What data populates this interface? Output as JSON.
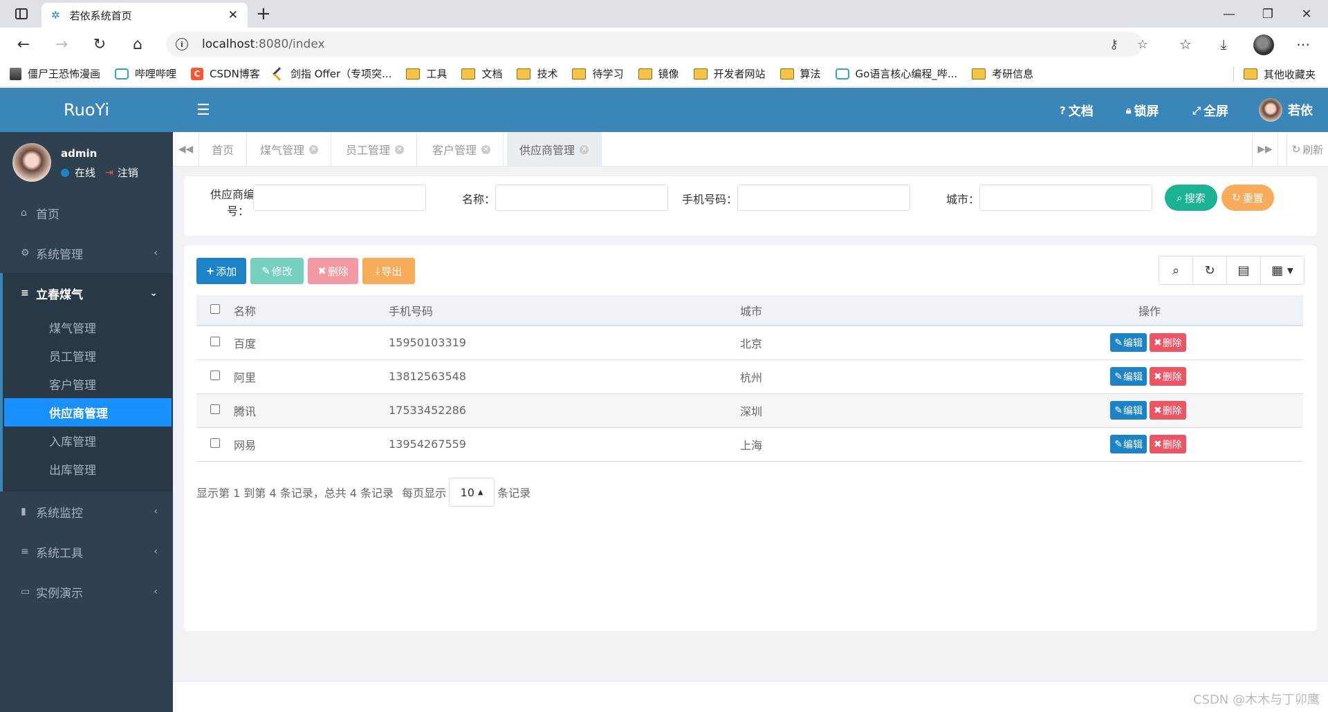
{
  "browser": {
    "tab_title": "若依系统首页",
    "url_host": "localhost",
    "url_rest": ":8080/index",
    "bookmarks": [
      {
        "label": "僵尸王恐怖漫画",
        "icon": "image-icon"
      },
      {
        "label": "哔哩哔哩",
        "icon": "bilibili-icon"
      },
      {
        "label": "CSDN博客",
        "icon": "csdn-icon"
      },
      {
        "label": "剑指 Offer（专项突...",
        "icon": "leetcode-icon"
      },
      {
        "label": "工具",
        "icon": "folder-icon"
      },
      {
        "label": "文档",
        "icon": "folder-icon"
      },
      {
        "label": "技术",
        "icon": "folder-icon"
      },
      {
        "label": "待学习",
        "icon": "folder-icon"
      },
      {
        "label": "镜像",
        "icon": "folder-icon"
      },
      {
        "label": "开发者网站",
        "icon": "folder-icon"
      },
      {
        "label": "算法",
        "icon": "folder-icon"
      },
      {
        "label": "Go语言核心编程_哔...",
        "icon": "bilibili-icon"
      },
      {
        "label": "考研信息",
        "icon": "folder-icon"
      }
    ],
    "other_bookmarks": "其他收藏夹"
  },
  "app": {
    "logo": "RuoYi",
    "user": {
      "name": "admin",
      "status": "在线",
      "logout": "注销"
    },
    "menu": {
      "home": "首页",
      "system": "系统管理",
      "lichun": "立春煤气",
      "sub": [
        "煤气管理",
        "员工管理",
        "客户管理",
        "供应商管理",
        "入库管理",
        "出库管理"
      ],
      "monitor": "系统监控",
      "tools": "系统工具",
      "demo": "实例演示"
    },
    "topbar": {
      "docs": "文档",
      "lock": "锁屏",
      "fullscreen": "全屏",
      "user": "若依"
    },
    "tabs": [
      "首页",
      "煤气管理",
      "员工管理",
      "客户管理",
      "供应商管理"
    ],
    "refresh": "刷新"
  },
  "search": {
    "label_code_1": "供应商编",
    "label_code_2": "号：",
    "label_name": "名称：",
    "label_phone": "手机号码：",
    "label_city": "城市：",
    "btn_search": "搜索",
    "btn_reset": "重置"
  },
  "toolbar": {
    "add": "添加",
    "edit": "修改",
    "delete": "删除",
    "export": "导出"
  },
  "table": {
    "headers": {
      "name": "名称",
      "phone": "手机号码",
      "city": "城市",
      "ops": "操作"
    },
    "rows": [
      {
        "name": "百度",
        "phone": "15950103319",
        "city": "北京"
      },
      {
        "name": "阿里",
        "phone": "13812563548",
        "city": "杭州"
      },
      {
        "name": "腾讯",
        "phone": "17533452286",
        "city": "深圳"
      },
      {
        "name": "网易",
        "phone": "13954267559",
        "city": "上海"
      }
    ],
    "row_edit": "编辑",
    "row_delete": "删除"
  },
  "pager": {
    "summary": "显示第 1 到第 4 条记录，总共 4 条记录",
    "per_page_label": "每页显示",
    "page_size": "10",
    "records_suffix": "条记录"
  },
  "footer": {
    "watermark": "CSDN @木木与丁卯鹰"
  },
  "colors": {
    "sidebar": "#2f4050",
    "header": "#3b86b9",
    "active_menu": "#1890ff",
    "primary": "#1c84c6",
    "success": "#1ab394",
    "warning": "#f8ac59",
    "danger": "#ed5565"
  }
}
